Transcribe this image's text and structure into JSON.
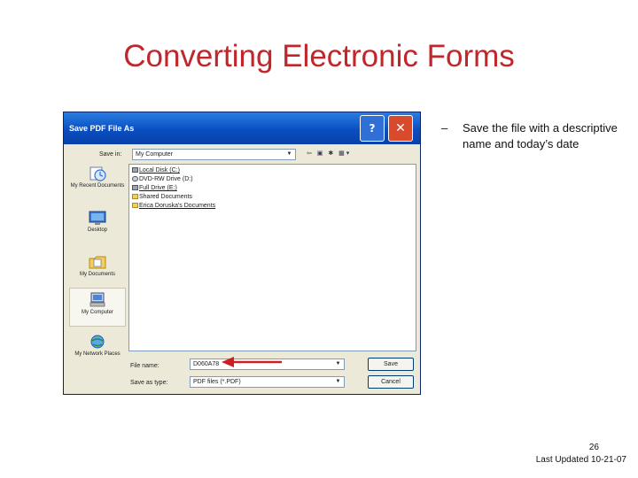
{
  "slide": {
    "title": "Converting Electronic Forms",
    "bullet_dash": "–",
    "bullet": "Save the file with a descriptive name and today’s date",
    "page_number": "26",
    "last_updated": "Last Updated 10-21-07"
  },
  "dialog": {
    "title": "Save PDF File As",
    "help_label": "?",
    "close_label": "✕",
    "save_in_label": "Save in:",
    "save_in_value": "My Computer",
    "places": [
      {
        "label": "My Recent Documents",
        "icon": "recent-documents-icon"
      },
      {
        "label": "Desktop",
        "icon": "desktop-icon"
      },
      {
        "label": "My Documents",
        "icon": "my-documents-icon"
      },
      {
        "label": "My Computer",
        "icon": "my-computer-icon"
      },
      {
        "label": "My Network Places",
        "icon": "network-places-icon"
      }
    ],
    "files": [
      {
        "label": "Local Disk (C:)",
        "icon": "drive-icon"
      },
      {
        "label": "DVD-RW Drive (D:)",
        "icon": "dvd-drive-icon"
      },
      {
        "label": "Full Drive (E:)",
        "icon": "drive-icon"
      },
      {
        "label": "Shared Documents",
        "icon": "folder-icon"
      },
      {
        "label": "Erica Doruska's Documents",
        "icon": "folder-icon"
      }
    ],
    "file_name_label": "File name:",
    "file_name_value": "D060A78",
    "save_as_type_label": "Save as type:",
    "save_as_type_value": "PDF files (*.PDF)",
    "save_button": "Save",
    "cancel_button": "Cancel",
    "toolbar_icons": "⇦ ▣ ✱ ▦▾"
  },
  "colors": {
    "title_red": "#c0262a",
    "titlebar_blue": "#0a4ec2",
    "dialog_bg": "#ece9d8",
    "arrow_red": "#cc1f1f"
  }
}
